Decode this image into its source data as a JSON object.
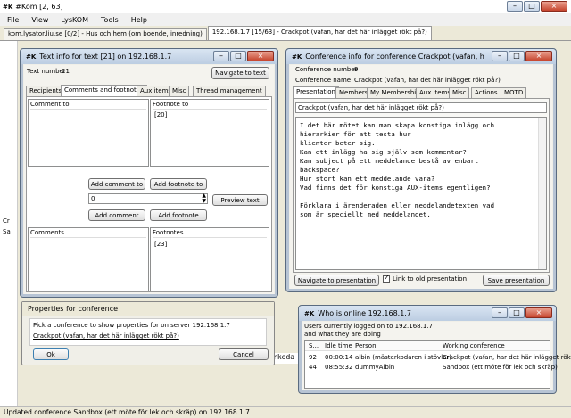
{
  "app": {
    "title": "#Kom [2, 63]",
    "logo": "#K",
    "window_buttons": {
      "minimize": "–",
      "maximize": "□",
      "close": "×"
    },
    "menu": [
      "File",
      "View",
      "LysKOM",
      "Tools",
      "Help"
    ],
    "tabs": [
      "kom.lysator.liu.se [0/2] - Hus och hem (om boende, inredning)",
      "192.168.1.7 [15/63] - Crackpot (vafan, har det här inlägget rökt på?)"
    ],
    "status": "Updated conference Sandbox (ett möte för lek och skräp) on 192.168.1.7."
  },
  "text_info": {
    "title": "Text info for text [21] on 192.168.1.7",
    "text_number_label": "Text number",
    "text_number": "21",
    "navigate_button": "Navigate to text",
    "tabs": [
      "Recipients",
      "Comments and footnotes",
      "Aux items",
      "Misc",
      "Thread management"
    ],
    "comment_to_header": "Comment to",
    "footnote_to_header": "Footnote to",
    "footnote_to_value": "[20]",
    "add_comment_to": "Add comment to",
    "add_footnote_to": "Add footnote to",
    "number_input": "0",
    "preview_button": "Preview text",
    "add_comment": "Add comment",
    "add_footnote": "Add footnote",
    "comments_header": "Comments",
    "footnotes_header": "Footnotes",
    "footnotes_value": "[23]"
  },
  "conf_info": {
    "title": "Conference info for conference Crackpot (vafan, har det här inlägget rökt på?)",
    "conf_number_label": "Conference number",
    "conf_number": "9",
    "conf_name_label": "Conference name",
    "conf_name": "Crackpot (vafan, har det här inlägget rökt på?)",
    "tabs": [
      "Presentation",
      "Members",
      "My Membership",
      "Aux items",
      "Misc",
      "Actions",
      "MOTD"
    ],
    "presentation_title": "Crackpot (vafan, har det här inlägget rökt på?)",
    "presentation_body": "I det här mötet kan man skapa konstiga inlägg och\nhierarkier för att testa hur\nklienter beter sig.\nKan ett inlägg ha sig själv som kommentar?\nKan subject på ett meddelande bestå av enbart\nbackspace?\nHur stort kan ett meddelande vara?\nVad finns det för konstiga AUX-items egentligen?\n\nFörklara i ärenderaden eller meddelandetexten vad\nsom är speciellt med meddelandet.",
    "navigate_button": "Navigate to presentation",
    "link_checkbox_label": "Link to old presentation",
    "save_button": "Save presentation"
  },
  "properties": {
    "title": "Properties for conference",
    "prompt": "Pick a conference to show properties for on server 192.168.1.7",
    "link": "Crackpot (vafan, har det här inlägget rökt på?)",
    "ok": "Ok",
    "cancel": "Cancel"
  },
  "who": {
    "title": "Who is online 192.168.1.7",
    "subtitle_1": "Users currently logged on to 192.168.1.7",
    "subtitle_2": "and what they are doing",
    "columns": [
      "S...",
      "Idle time",
      "Person",
      "Working conference"
    ],
    "rows": [
      [
        "92",
        "00:00:14",
        "albin (mästerkodaren i stövlar)",
        "Crackpot (vafan, har det här inlägget rökt på?)"
      ],
      [
        "44",
        "08:55:32",
        "dummyAlbin",
        "Sandbox (ett möte för lek och skräp)"
      ]
    ]
  },
  "background_fragments": {
    "left_labels": [
      "Cr",
      "Sa"
    ],
    "partial": "rkoda"
  }
}
